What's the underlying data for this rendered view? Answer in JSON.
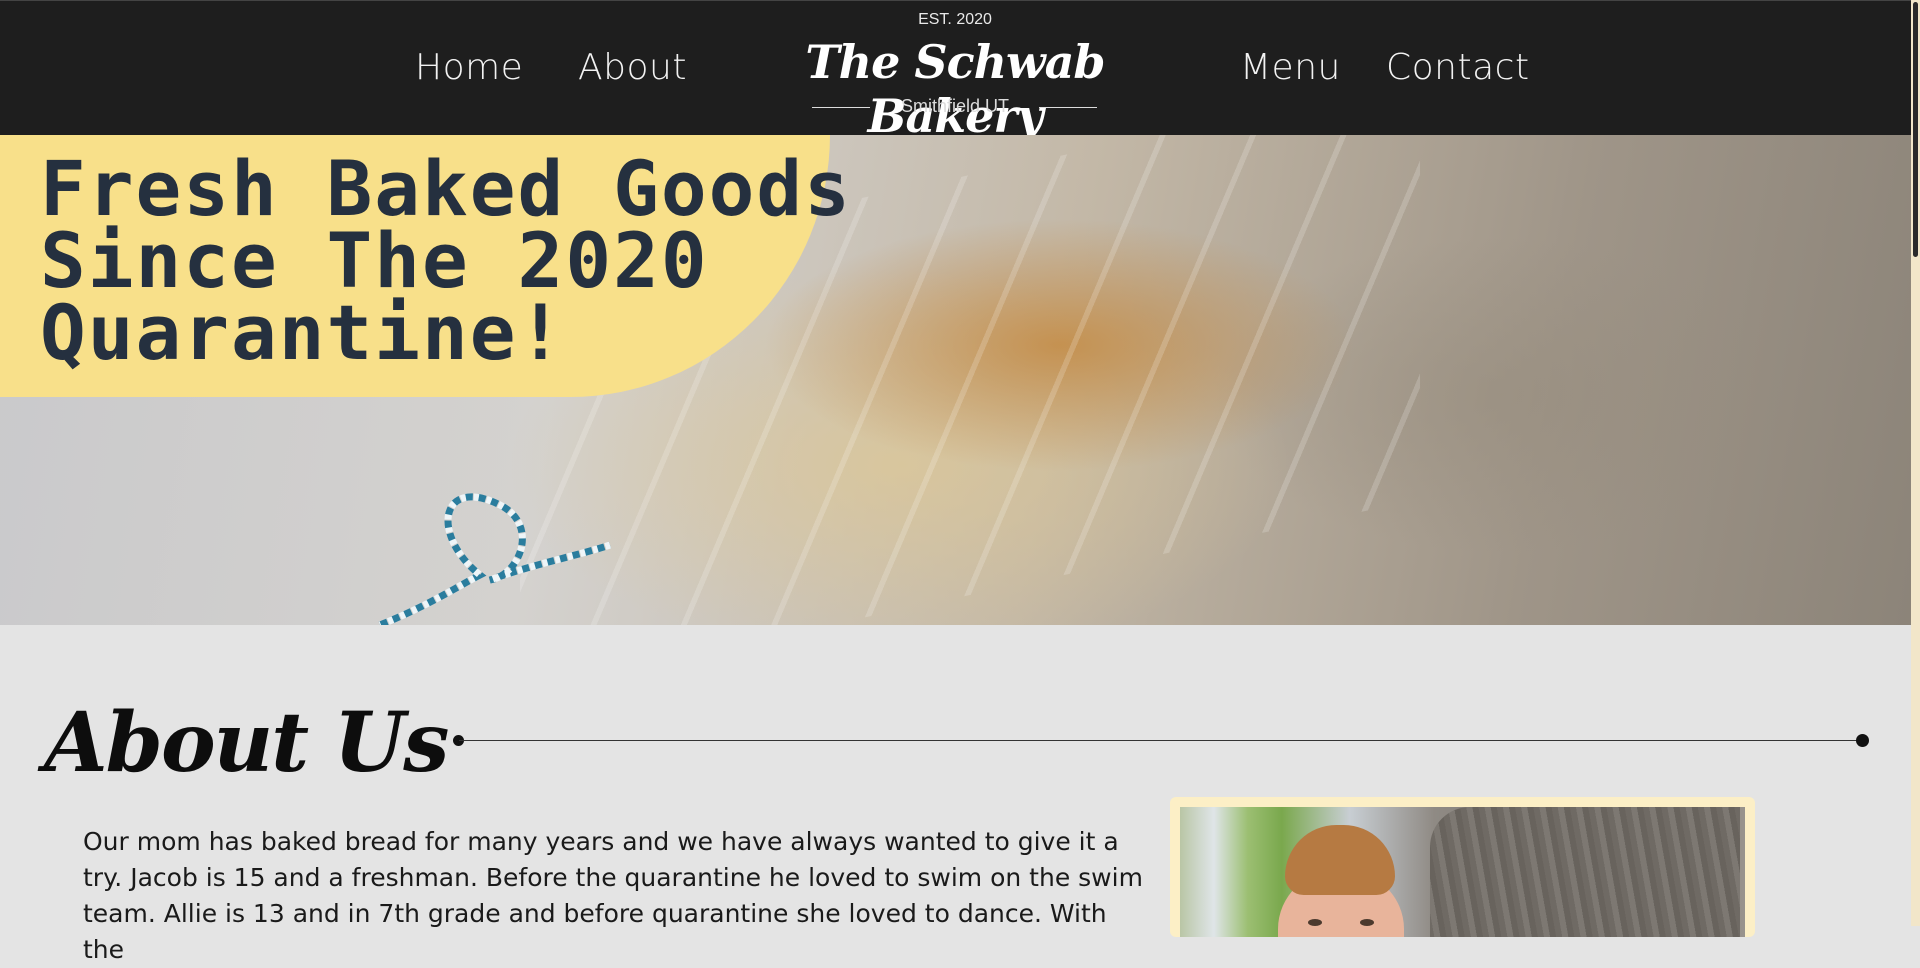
{
  "header": {
    "nav_left": [
      "Home",
      "About"
    ],
    "nav_right": [
      "Menu",
      "Contact"
    ],
    "brand": {
      "established": "EST. 2020",
      "name": "The Schwab Bakery",
      "location": "Smithfield UT"
    }
  },
  "hero": {
    "headline_lines": [
      "Fresh Baked Goods",
      "Since The 2020",
      "Quarantine!"
    ]
  },
  "about": {
    "title": "About Us",
    "paragraph": "Our mom has baked bread for many years and we have always wanted to give it a try. Jacob is 15 and a freshman. Before the quarantine he loved to swim on the swim team. Allie is 13 and in 7th grade and before quarantine she loved to dance. With the"
  },
  "colors": {
    "header_bg": "#1e1e1e",
    "headline_box": "#f8e08a",
    "headline_text": "#25303f",
    "page_bg": "#e4e4e4",
    "photo_frame": "#fcefc6"
  },
  "icons": [
    "bread-photo",
    "family-photo"
  ]
}
